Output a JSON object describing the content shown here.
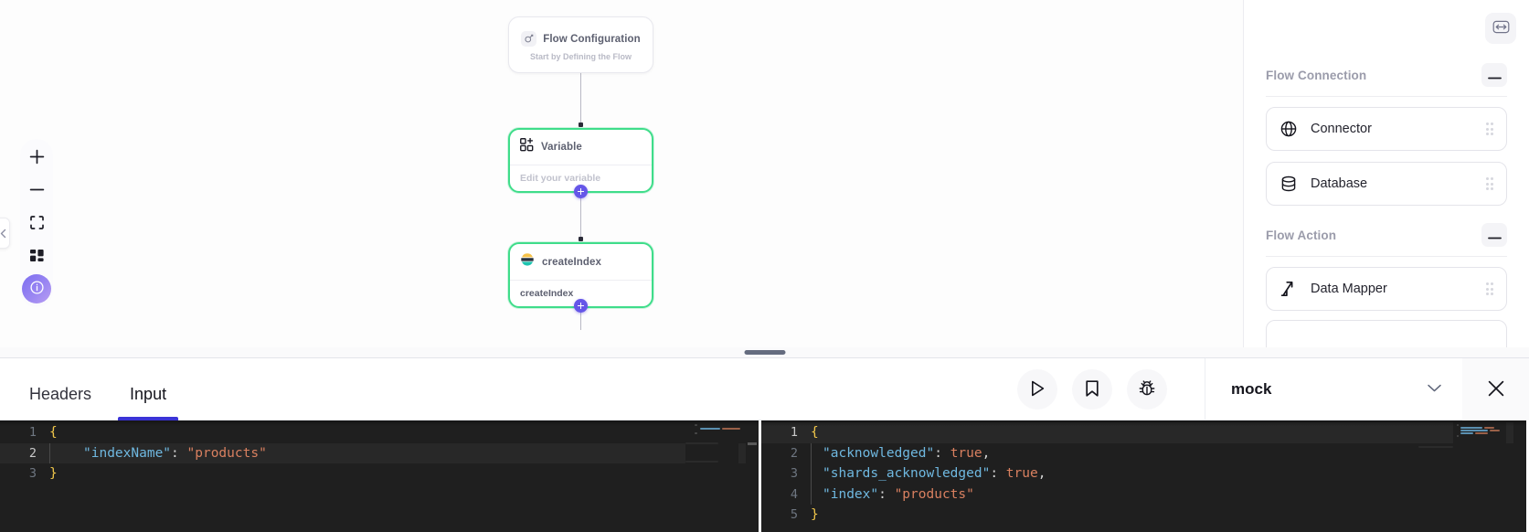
{
  "canvas": {
    "toolbar": {
      "zoom_in": "zoom-in",
      "zoom_out": "zoom-out",
      "fit_view": "fit-view",
      "layout": "layout",
      "info": "info"
    },
    "nodes": [
      {
        "id": "flow-configuration",
        "title": "Flow Configuration",
        "subtitle": "Start by Defining the Flow",
        "icon": "flow-config-icon",
        "selected": false
      },
      {
        "id": "variable",
        "title": "Variable",
        "body": "Edit your variable",
        "icon": "variable-icon",
        "selected": true
      },
      {
        "id": "createindex",
        "title": "createIndex",
        "body": "createIndex",
        "icon": "elasticsearch-icon",
        "selected": true
      }
    ],
    "add_node_label": "+"
  },
  "sidebar": {
    "expand_button": "expand-panel-icon",
    "sections": [
      {
        "title": "Flow Connection",
        "collapse_label": "—",
        "items": [
          {
            "label": "Connector",
            "icon": "globe-icon"
          },
          {
            "label": "Database",
            "icon": "database-icon"
          }
        ]
      },
      {
        "title": "Flow Action",
        "collapse_label": "—",
        "items": [
          {
            "label": "Data Mapper",
            "icon": "data-mapper-icon"
          }
        ]
      }
    ]
  },
  "bottom_panel": {
    "tabs": [
      {
        "label": "Headers",
        "active": false
      },
      {
        "label": "Input",
        "active": true
      }
    ],
    "actions": [
      {
        "name": "run-button",
        "icon": "play-icon"
      },
      {
        "name": "save-button",
        "icon": "bookmark-icon"
      },
      {
        "name": "debug-button",
        "icon": "bug-icon"
      }
    ],
    "mock_select": {
      "value": "mock",
      "chevron": "chevron-down-icon"
    },
    "close_label": "close-icon"
  },
  "editors": {
    "input": {
      "active_line": 2,
      "lines": [
        {
          "n": "1",
          "tokens": [
            {
              "t": "{",
              "c": "tk-brace"
            }
          ]
        },
        {
          "n": "2",
          "indent": 1,
          "tokens": [
            {
              "t": "\"indexName\"",
              "c": "tk-key"
            },
            {
              "t": ": ",
              "c": "tk-punc"
            },
            {
              "t": "\"products\"",
              "c": "tk-str"
            }
          ]
        },
        {
          "n": "3",
          "tokens": [
            {
              "t": "}",
              "c": "tk-brace"
            }
          ]
        }
      ]
    },
    "output": {
      "active_line": 1,
      "lines": [
        {
          "n": "1",
          "tokens": [
            {
              "t": "{",
              "c": "tk-brace"
            }
          ]
        },
        {
          "n": "2",
          "indent": 1,
          "tokens": [
            {
              "t": "\"acknowledged\"",
              "c": "tk-key"
            },
            {
              "t": ": ",
              "c": "tk-punc"
            },
            {
              "t": "true",
              "c": "tk-bool"
            },
            {
              "t": ",",
              "c": "tk-punc"
            }
          ]
        },
        {
          "n": "3",
          "indent": 1,
          "tokens": [
            {
              "t": "\"shards_acknowledged\"",
              "c": "tk-key"
            },
            {
              "t": ": ",
              "c": "tk-punc"
            },
            {
              "t": "true",
              "c": "tk-bool"
            },
            {
              "t": ",",
              "c": "tk-punc"
            }
          ]
        },
        {
          "n": "4",
          "indent": 1,
          "tokens": [
            {
              "t": "\"index\"",
              "c": "tk-key"
            },
            {
              "t": ": ",
              "c": "tk-punc"
            },
            {
              "t": "\"products\"",
              "c": "tk-str"
            }
          ]
        },
        {
          "n": "5",
          "tokens": [
            {
              "t": "}",
              "c": "tk-brace"
            }
          ]
        }
      ]
    }
  },
  "colors": {
    "accent_purple": "#6556e8",
    "tab_underline": "#3b34d6",
    "node_selected": "#3fdd8a",
    "editor_bg": "#1f1f1f"
  }
}
